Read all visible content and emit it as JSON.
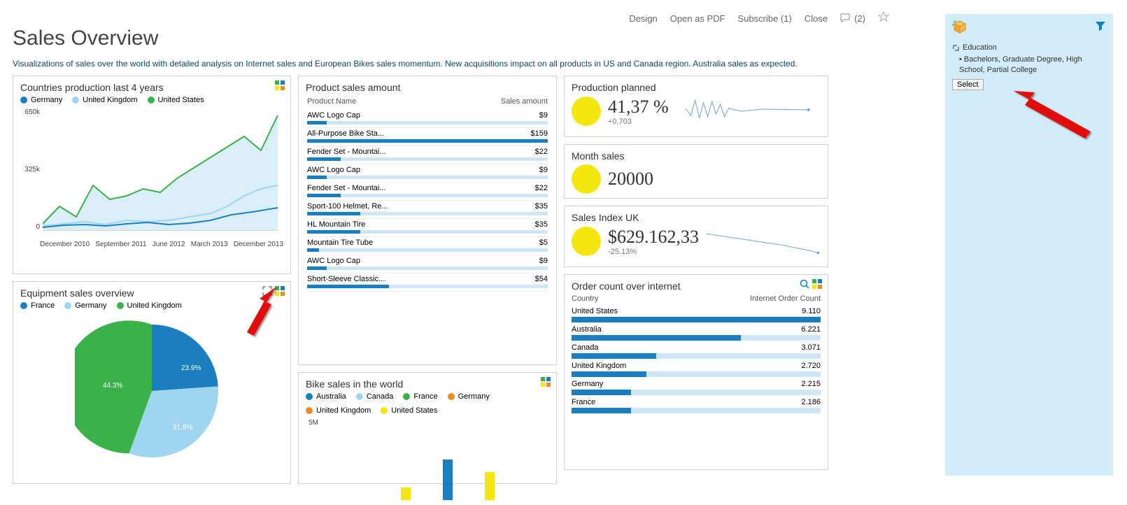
{
  "toolbar": {
    "design": "Design",
    "open_pdf": "Open as PDF",
    "subscribe": "Subscribe (1)",
    "close": "Close",
    "comments": "(2)"
  },
  "page": {
    "title": "Sales Overview",
    "subtitle": "Visualizations of sales over the world with detailed analysis on Internet sales and European Bikes sales momentum. New acquisitions impact on all products in US and Canada region. Australia sales as expected."
  },
  "countries_chart": {
    "title": "Countries production last 4 years",
    "legend": [
      "Germany",
      "United Kingdom",
      "United States"
    ],
    "yticks": [
      "650k",
      "325k",
      "0"
    ],
    "xticks": [
      "December 2010",
      "September 2011",
      "June 2012",
      "March 2013",
      "December 2013"
    ]
  },
  "equipment_pie": {
    "title": "Equipment sales overview",
    "legend": [
      "France",
      "Germany",
      "United Kingdom"
    ],
    "slices": [
      {
        "label": "23.9%",
        "value": 23.9,
        "color": "#1b7fbf"
      },
      {
        "label": "31.8%",
        "value": 31.8,
        "color": "#9fd5ee"
      },
      {
        "label": "44.3%",
        "value": 44.3,
        "color": "#3bb14a"
      }
    ]
  },
  "product_sales": {
    "title": "Product sales amount",
    "col1": "Product Name",
    "col2": "Sales amount",
    "rows": [
      {
        "name": "AWC Logo Cap",
        "amount": "$9",
        "bar": 8
      },
      {
        "name": "All-Purpose Bike Sta...",
        "amount": "$159",
        "bar": 100
      },
      {
        "name": "Fender Set - Mountai...",
        "amount": "$22",
        "bar": 14
      },
      {
        "name": "AWC Logo Cap",
        "amount": "$9",
        "bar": 8
      },
      {
        "name": "Fender Set - Mountai...",
        "amount": "$22",
        "bar": 14
      },
      {
        "name": "Sport-100 Helmet, Re...",
        "amount": "$35",
        "bar": 22
      },
      {
        "name": "HL Mountain Tire",
        "amount": "$35",
        "bar": 22
      },
      {
        "name": "Mountain Tire Tube",
        "amount": "$5",
        "bar": 5
      },
      {
        "name": "AWC Logo Cap",
        "amount": "$9",
        "bar": 8
      },
      {
        "name": "Short-Sleeve Classic...",
        "amount": "$54",
        "bar": 34
      }
    ]
  },
  "bike_sales": {
    "title": "Bike sales in the world",
    "legend": [
      "Australia",
      "Canada",
      "France",
      "Germany",
      "United Kingdom",
      "United States"
    ],
    "ytick": "5M"
  },
  "kpi_production": {
    "title": "Production planned",
    "value": "41,37 %",
    "delta": "+0,703"
  },
  "kpi_month": {
    "title": "Month sales",
    "value": "20000"
  },
  "kpi_uk": {
    "title": "Sales Index UK",
    "value": "$629.162,33",
    "delta": "-25.13%"
  },
  "order_count": {
    "title": "Order count over internet",
    "col1": "Country",
    "col2": "Internet Order Count",
    "rows": [
      {
        "name": "United States",
        "value": "9.110",
        "bar": 100
      },
      {
        "name": "Australia",
        "value": "6.221",
        "bar": 68
      },
      {
        "name": "Canada",
        "value": "3.071",
        "bar": 34
      },
      {
        "name": "United Kingdom",
        "value": "2.720",
        "bar": 30
      },
      {
        "name": "Germany",
        "value": "2.215",
        "bar": 24
      },
      {
        "name": "France",
        "value": "2.186",
        "bar": 24
      }
    ]
  },
  "filter": {
    "field": "Education",
    "values": "Bachelors, Graduate Degree, High School, Partial College",
    "select": "Select"
  },
  "chart_data": [
    {
      "id": "countries_production",
      "type": "line",
      "title": "Countries production last 4 years",
      "x_range": [
        "December 2010",
        "December 2013"
      ],
      "ylim": [
        0,
        650000
      ],
      "series": [
        {
          "name": "Germany",
          "color": "#1b7fbf",
          "approx_values": [
            20000,
            35000,
            40000,
            30000,
            50000,
            60000,
            45000,
            40000,
            60000,
            80000,
            120000,
            100000,
            140000,
            150000
          ]
        },
        {
          "name": "United Kingdom",
          "color": "#9fd5ee",
          "approx_values": [
            25000,
            30000,
            45000,
            35000,
            55000,
            40000,
            60000,
            50000,
            70000,
            90000,
            130000,
            160000,
            200000,
            220000
          ]
        },
        {
          "name": "United States",
          "color": "#3bb14a",
          "approx_values": [
            30000,
            100000,
            50000,
            200000,
            120000,
            140000,
            180000,
            160000,
            220000,
            300000,
            400000,
            500000,
            450000,
            620000
          ]
        }
      ]
    },
    {
      "id": "equipment_sales",
      "type": "pie",
      "title": "Equipment sales overview",
      "slices": [
        {
          "name": "France",
          "value": 23.9,
          "color": "#1b7fbf"
        },
        {
          "name": "Germany",
          "value": 31.8,
          "color": "#9fd5ee"
        },
        {
          "name": "United Kingdom",
          "value": 44.3,
          "color": "#3bb14a"
        }
      ]
    },
    {
      "id": "product_sales_amount",
      "type": "bar",
      "orientation": "horizontal",
      "title": "Product sales amount",
      "categories": [
        "AWC Logo Cap",
        "All-Purpose Bike Sta...",
        "Fender Set - Mountai...",
        "AWC Logo Cap",
        "Fender Set - Mountai...",
        "Sport-100 Helmet, Re...",
        "HL Mountain Tire",
        "Mountain Tire Tube",
        "AWC Logo Cap",
        "Short-Sleeve Classic..."
      ],
      "values": [
        9,
        159,
        22,
        9,
        22,
        35,
        35,
        5,
        9,
        54
      ]
    },
    {
      "id": "bike_sales_world",
      "type": "bar",
      "title": "Bike sales in the world",
      "categories": [
        "Australia",
        "Canada",
        "France",
        "Germany",
        "United Kingdom",
        "United States"
      ],
      "values": [
        null,
        null,
        null,
        null,
        null,
        null
      ],
      "ylim": [
        0,
        5000000
      ]
    },
    {
      "id": "production_planned_spark",
      "type": "line",
      "title": "Production planned sparkline",
      "approx_values": [
        41,
        38,
        45,
        35,
        48,
        40,
        36,
        39,
        37,
        35,
        34,
        35
      ]
    },
    {
      "id": "sales_index_uk_spark",
      "type": "line",
      "title": "Sales Index UK sparkline",
      "approx_values": [
        640000,
        638000,
        636000,
        634000,
        632000,
        630000,
        629162
      ]
    },
    {
      "id": "order_count_internet",
      "type": "bar",
      "orientation": "horizontal",
      "title": "Order count over internet",
      "categories": [
        "United States",
        "Australia",
        "Canada",
        "United Kingdom",
        "Germany",
        "France"
      ],
      "values": [
        9110,
        6221,
        3071,
        2720,
        2215,
        2186
      ]
    }
  ]
}
